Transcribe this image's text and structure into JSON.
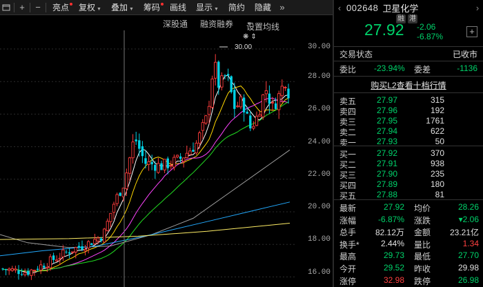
{
  "toolbar": {
    "icons": [
      "window-icon",
      "add-icon",
      "remove-icon"
    ],
    "buttons": [
      {
        "label": "亮点",
        "dot": true,
        "caret": false
      },
      {
        "label": "复权",
        "dot": false,
        "caret": true
      },
      {
        "label": "叠加",
        "dot": false,
        "caret": true
      },
      {
        "label": "筹码",
        "dot": true,
        "caret": false
      },
      {
        "label": "画线",
        "dot": false,
        "caret": false
      },
      {
        "label": "显示",
        "dot": false,
        "caret": true
      },
      {
        "label": "简约",
        "dot": false,
        "caret": false
      },
      {
        "label": "隐藏",
        "dot": false,
        "caret": false
      }
    ],
    "more": "»"
  },
  "subbar": {
    "link1": "深股通",
    "link2": "融资融券",
    "link3": "设置均线",
    "link3_caret": "▾"
  },
  "chart": {
    "high_marker": "30.00",
    "y_ticks": [
      "30.00",
      "28.00",
      "26.00",
      "24.00",
      "22.00",
      "20.00",
      "18.00",
      "16.00"
    ],
    "colors": {
      "up": "#ff3c3c",
      "down": "#00d2e6",
      "ma5": "#ffffff",
      "ma10": "#ffd700",
      "ma20": "#ff44ff",
      "ma30": "#22dd22",
      "ma60": "#a0a0a0",
      "ma120": "#22aaff",
      "ma250": "#ffee66"
    }
  },
  "quote": {
    "code": "002648",
    "name": "卫星化学",
    "tag1": "融",
    "tag2": "港",
    "price": "27.92",
    "change": "-2.06",
    "change_pct": "-6.87%",
    "status_label": "交易状态",
    "status_value": "已收市",
    "weibi_label": "委比",
    "weibi_value": "-23.94%",
    "weicha_label": "委差",
    "weicha_value": "-1136",
    "l2_link": "购买L2查看十档行情"
  },
  "sells": [
    {
      "label": "卖五",
      "price": "27.97",
      "vol": "315"
    },
    {
      "label": "卖四",
      "price": "27.96",
      "vol": "192"
    },
    {
      "label": "卖三",
      "price": "27.95",
      "vol": "1761"
    },
    {
      "label": "卖二",
      "price": "27.94",
      "vol": "622"
    },
    {
      "label": "卖一",
      "price": "27.93",
      "vol": "50"
    }
  ],
  "buys": [
    {
      "label": "买一",
      "price": "27.92",
      "vol": "370"
    },
    {
      "label": "买二",
      "price": "27.91",
      "vol": "938"
    },
    {
      "label": "买三",
      "price": "27.90",
      "vol": "235"
    },
    {
      "label": "买四",
      "price": "27.89",
      "vol": "180"
    },
    {
      "label": "买五",
      "price": "27.88",
      "vol": "81"
    }
  ],
  "stats": [
    {
      "l1": "最新",
      "v1": "27.92",
      "c1": "grn",
      "l2": "均价",
      "v2": "28.26",
      "c2": "grn"
    },
    {
      "l1": "涨幅",
      "v1": "-6.87%",
      "c1": "grn",
      "l2": "涨跌",
      "v2": "▾2.06",
      "c2": "grn"
    },
    {
      "l1": "总手",
      "v1": "82.12万",
      "c1": "wht",
      "l2": "金额",
      "v2": "23.21亿",
      "c2": "wht"
    },
    {
      "l1": "换手*",
      "v1": "2.44%",
      "c1": "wht",
      "l2": "量比",
      "v2": "1.34",
      "c2": "red"
    },
    {
      "l1": "最高",
      "v1": "29.73",
      "c1": "grn",
      "l2": "最低",
      "v2": "27.70",
      "c2": "grn"
    },
    {
      "l1": "今开",
      "v1": "29.52",
      "c1": "grn",
      "l2": "昨收",
      "v2": "29.98",
      "c2": "wht"
    },
    {
      "l1": "涨停",
      "v1": "32.98",
      "c1": "red",
      "l2": "跌停",
      "v2": "26.98",
      "c2": "grn"
    }
  ]
}
